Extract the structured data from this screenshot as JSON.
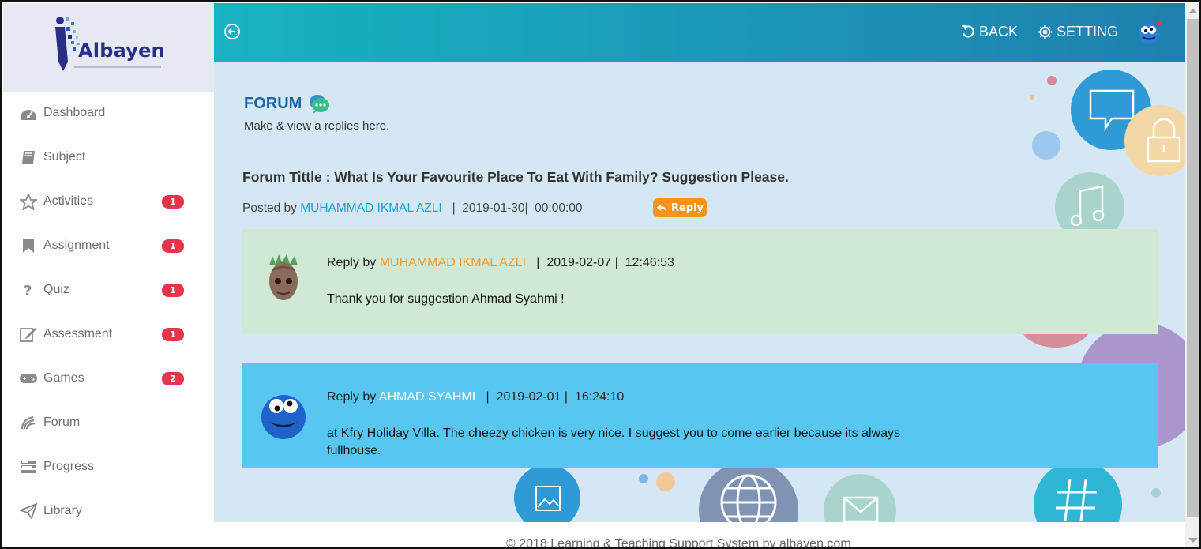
{
  "brand": {
    "name": "Albayen",
    "accent": "#2a2d8a"
  },
  "colors": {
    "header_start": "#18b3c4",
    "header_end": "#1f7fae",
    "badge": "#e8344a",
    "reply_button": "#f59419",
    "link_blue": "#1aa0d8",
    "reply_green_bg": "#d0e9d4",
    "reply_blue_bg": "#57c7f2"
  },
  "sidebar": {
    "items": [
      {
        "label": "Dashboard",
        "icon": "dashboard-icon",
        "badge": ""
      },
      {
        "label": "Subject",
        "icon": "book-icon",
        "badge": ""
      },
      {
        "label": "Activities",
        "icon": "star-icon",
        "badge": "1"
      },
      {
        "label": "Assignment",
        "icon": "bookmark-icon",
        "badge": "1"
      },
      {
        "label": "Quiz",
        "icon": "question-icon",
        "badge": "1"
      },
      {
        "label": "Assessment",
        "icon": "edit-icon",
        "badge": "1"
      },
      {
        "label": "Games",
        "icon": "gamepad-icon",
        "badge": "2"
      },
      {
        "label": "Forum",
        "icon": "forum-icon",
        "badge": ""
      },
      {
        "label": "Progress",
        "icon": "progress-icon",
        "badge": ""
      },
      {
        "label": "Library",
        "icon": "send-icon",
        "badge": ""
      }
    ]
  },
  "header": {
    "back_label": "BACK",
    "setting_label": "SETTING"
  },
  "page": {
    "title": "FORUM",
    "subtitle": "Make & view a replies here."
  },
  "topic": {
    "title": "Forum Tittle : What Is Your Favourite Place To Eat With Family? Suggestion Please.",
    "posted_prefix": "Posted by",
    "author": "MUHAMMAD IKMAL AZLI",
    "date_time": "  |  2019-01-30|  00:00:00",
    "reply_label": "Reply"
  },
  "replies": [
    {
      "prefix": "Reply by",
      "author": "MUHAMMAD IKMAL AZLI",
      "date_time": "  |  2019-02-07 |  12:46:53",
      "text": "Thank you for suggestion Ahmad Syahmi !"
    },
    {
      "prefix": "Reply by",
      "author": "AHMAD SYAHMI",
      "date_time": "  |  2019-02-01 |  16:24:10",
      "text": "at Kfry Holiday Villa. The cheezy chicken is very nice. I suggest you to come earlier because its always fullhouse."
    }
  ],
  "footer": {
    "text": "© 2018 Learning & Teaching Support System by albayen.com"
  }
}
